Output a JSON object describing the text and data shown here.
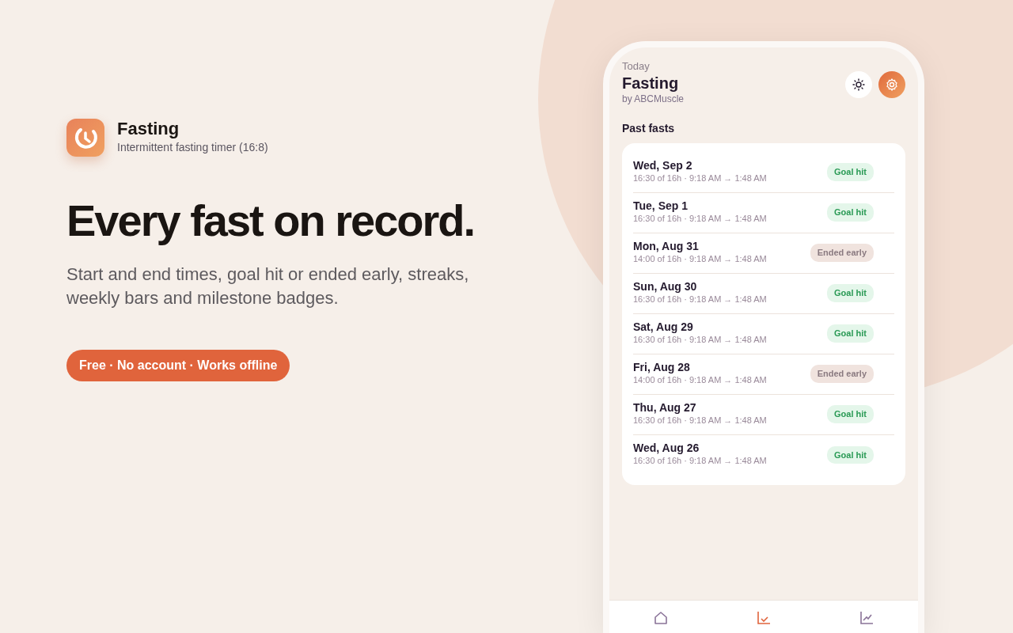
{
  "app": {
    "name": "Fasting",
    "subtitle": "Intermittent fasting timer (16:8)"
  },
  "hero": {
    "headline": "Every fast on record.",
    "description": "Start and end times, goal hit or ended early, streaks, weekly bars and milestone badges.",
    "cta": "Free · No account · Works offline"
  },
  "phone": {
    "overline": "Today",
    "title": "Fasting",
    "byline": "by ABCMuscle",
    "section_title": "Past fasts",
    "fasts": [
      {
        "date": "Wed, Sep 2",
        "detail": "16:30 of 16h · 9:18 AM → 1:48 AM",
        "kind": "goal_hit",
        "badge": "Goal hit"
      },
      {
        "date": "Tue, Sep 1",
        "detail": "16:30 of 16h · 9:18 AM → 1:48 AM",
        "kind": "goal_hit",
        "badge": "Goal hit"
      },
      {
        "date": "Mon, Aug 31",
        "detail": "14:00 of 16h · 9:18 AM → 1:48 AM",
        "kind": "ended_early",
        "badge": "Ended early"
      },
      {
        "date": "Sun, Aug 30",
        "detail": "16:30 of 16h · 9:18 AM → 1:48 AM",
        "kind": "goal_hit",
        "badge": "Goal hit"
      },
      {
        "date": "Sat, Aug 29",
        "detail": "16:30 of 16h · 9:18 AM → 1:48 AM",
        "kind": "goal_hit",
        "badge": "Goal hit"
      },
      {
        "date": "Fri, Aug 28",
        "detail": "14:00 of 16h · 9:18 AM → 1:48 AM",
        "kind": "ended_early",
        "badge": "Ended early"
      },
      {
        "date": "Thu, Aug 27",
        "detail": "16:30 of 16h · 9:18 AM → 1:48 AM",
        "kind": "goal_hit",
        "badge": "Goal hit"
      },
      {
        "date": "Wed, Aug 26",
        "detail": "16:30 of 16h · 9:18 AM → 1:48 AM",
        "kind": "goal_hit",
        "badge": "Goal hit"
      }
    ],
    "tabs": [
      {
        "kind": "home",
        "selected": false
      },
      {
        "kind": "history",
        "selected": true
      },
      {
        "kind": "progress",
        "selected": false
      }
    ]
  }
}
